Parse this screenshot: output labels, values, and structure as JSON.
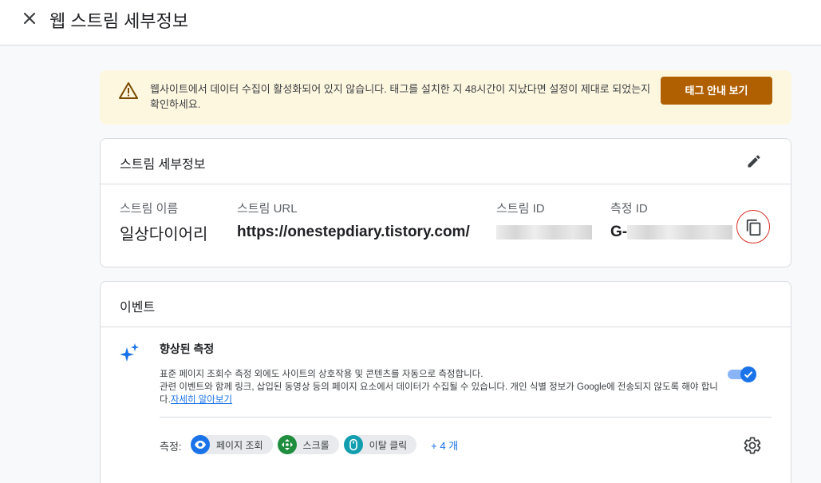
{
  "header": {
    "title": "웹 스트림 세부정보"
  },
  "banner": {
    "text": "웹사이트에서 데이터 수집이 활성화되어 있지 않습니다. 태그를 설치한 지 48시간이 지났다면 설정이 제대로 되었는지 확인하세요.",
    "button_label": "태그 안내 보기",
    "accent_color": "#b06000"
  },
  "stream_card": {
    "title": "스트림 세부정보",
    "name_label": "스트림 이름",
    "name_value": "일상다이어리",
    "url_label": "스트림 URL",
    "url_value": "https://onestepdiary.tistory.com/",
    "id_label": "스트림 ID",
    "measure_label": "측정 ID",
    "measure_prefix": "G-"
  },
  "events_card": {
    "title": "이벤트",
    "enhanced_title": "향상된 측정",
    "desc_line1": "표준 페이지 조회수 측정 외에도 사이트의 상호작용 및 콘텐츠를 자동으로 측정합니다.",
    "desc_line2": "관련 이벤트와 함께 링크, 삽입된 동영상 등의 페이지 요소에서 데이터가 수집될 수 있습니다. 개인 식별 정보가 Google에 전송되지 않도록 해야 합니다.",
    "learn_more": "자세히 알아보기",
    "toggle_on": true,
    "measure_label": "측정:",
    "chips": [
      {
        "label": "페이지 조회",
        "icon": "eye-icon",
        "color": "#1a73e8"
      },
      {
        "label": "스크롤",
        "icon": "scroll-arrows-icon",
        "color": "#1e8e3e"
      },
      {
        "label": "이탈 클릭",
        "icon": "mouse-icon",
        "color": "#129eaf"
      }
    ],
    "more_label": "+ 4 개"
  }
}
